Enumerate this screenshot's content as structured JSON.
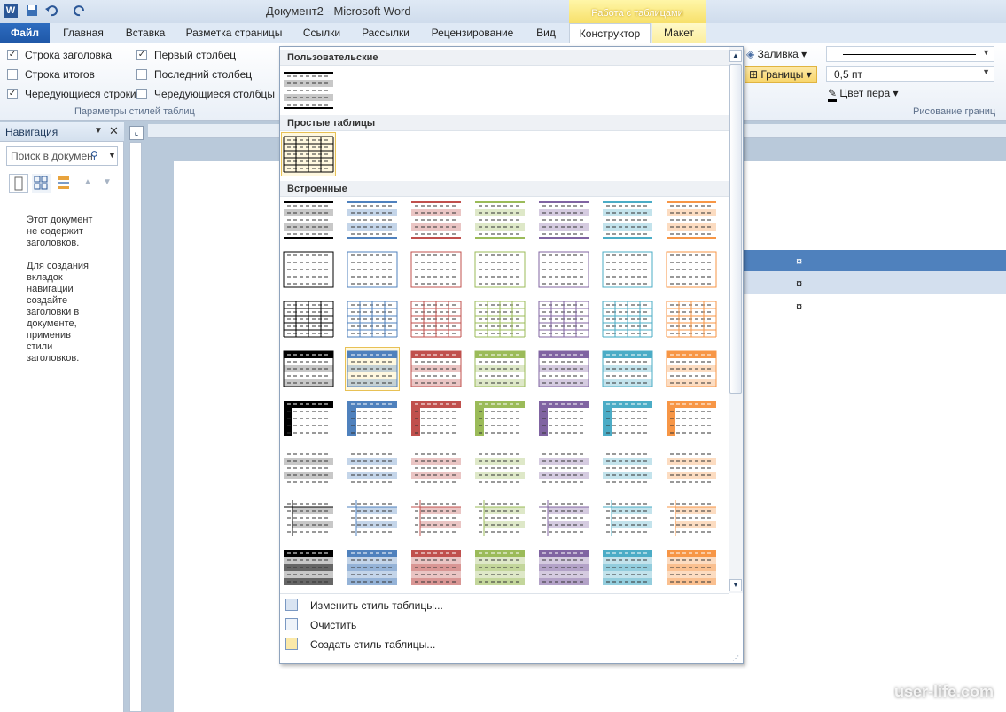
{
  "window": {
    "title": "Документ2  -  Microsoft Word",
    "context_group": "Работа с таблицами"
  },
  "tabs": [
    "Файл",
    "Главная",
    "Вставка",
    "Разметка страницы",
    "Ссылки",
    "Рассылки",
    "Рецензирование",
    "Вид",
    "Конструктор",
    "Макет"
  ],
  "style_options": {
    "items": [
      {
        "label": "Строка заголовка",
        "checked": true
      },
      {
        "label": "Строка итогов",
        "checked": false
      },
      {
        "label": "Чередующиеся строки",
        "checked": true
      },
      {
        "label": "Первый столбец",
        "checked": true
      },
      {
        "label": "Последний столбец",
        "checked": false
      },
      {
        "label": "Чередующиеся столбцы",
        "checked": false
      }
    ],
    "group_label": "Параметры стилей таблиц"
  },
  "borders": {
    "fill_label": "Заливка",
    "borders_label": "Границы",
    "width_value": "0,5 пт",
    "pen_color_label": "Цвет пера",
    "group_label": "Рисование границ"
  },
  "navigation": {
    "title": "Навигация",
    "search_placeholder": "Поиск в докумен",
    "message": "Этот документ\nне содержит\nзаголовков.\n\nДля создания\nвкладок\nнавигации\nсоздайте\nзаголовки в\nдокументе,\nприменив\nстили\nзаголовков."
  },
  "gallery": {
    "sections": [
      "Пользовательские",
      "Простые таблицы",
      "Встроенные"
    ],
    "accent_colors": [
      "#000000",
      "#4f81bd",
      "#c0504d",
      "#9bbb59",
      "#8064a2",
      "#4bacc6",
      "#f79646"
    ],
    "menu": [
      "Изменить стиль таблицы...",
      "Очистить",
      "Создать стиль таблицы..."
    ]
  },
  "document": {
    "cell_mark": "¤"
  },
  "watermark": "user-life.com"
}
